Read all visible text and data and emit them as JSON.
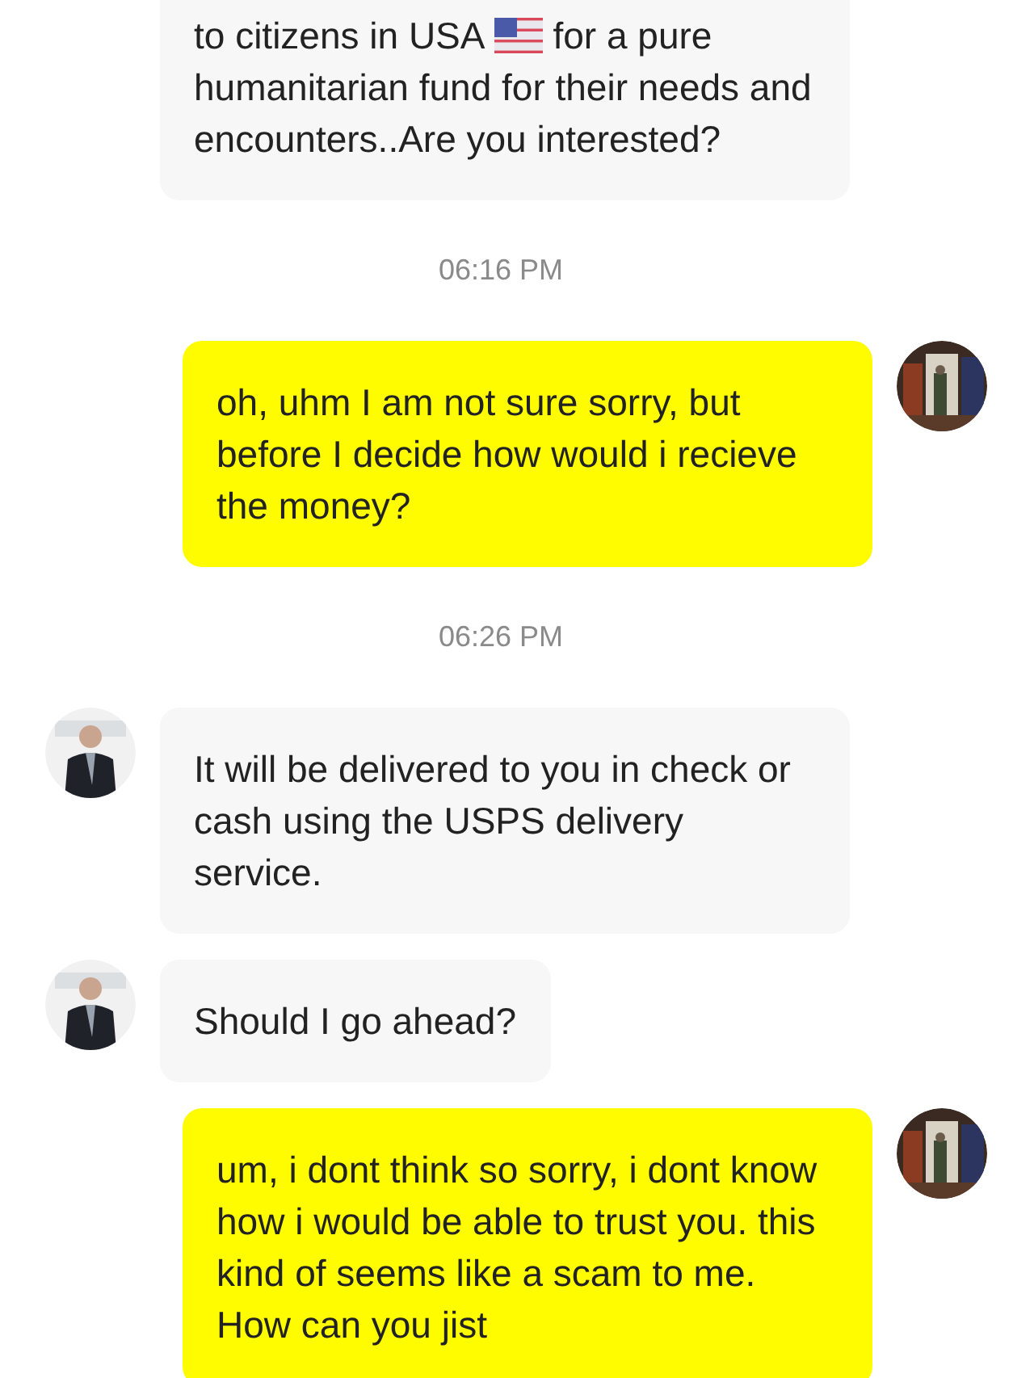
{
  "messages": [
    {
      "kind": "incoming",
      "first_line": [
        "to citizens in USA",
        "for a pure"
      ],
      "text": "humanitarian fund for their needs and encounters..Are you interested?"
    },
    {
      "kind": "time",
      "text": "06:16 PM"
    },
    {
      "kind": "outgoing",
      "avatar": true,
      "text": "oh, uhm I am not sure sorry, but before I decide how would i recieve the money?"
    },
    {
      "kind": "time",
      "text": "06:26 PM"
    },
    {
      "kind": "incoming",
      "avatar": true,
      "text": "It will be delivered to you in check or cash using the USPS delivery service."
    },
    {
      "kind": "incoming",
      "avatar": true,
      "text": "Should I go ahead?"
    },
    {
      "kind": "outgoing",
      "avatar": true,
      "text": "um, i dont think so sorry, i dont know how i would be able to trust you. this kind of seems like a scam to me. How can you jist"
    }
  ]
}
